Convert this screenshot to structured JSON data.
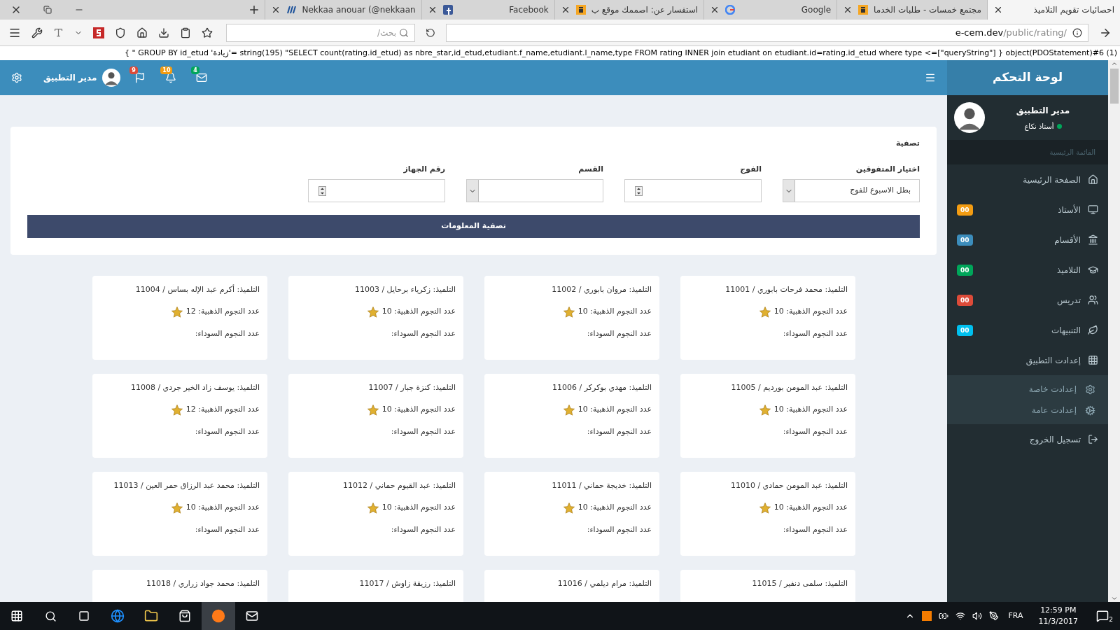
{
  "browser": {
    "tabs": [
      {
        "title": "احصائيات تقويم التلاميذ",
        "selected": true
      },
      {
        "title": "مجتمع خمسات - طلبات الخدما",
        "selected": false,
        "kind": "orange"
      },
      {
        "title": "Google",
        "selected": false,
        "kind": "google"
      },
      {
        "title": "استفسار عن: اصممك موقع ب",
        "selected": false,
        "kind": "orange"
      },
      {
        "title": "Facebook",
        "selected": false,
        "kind": "facebook"
      },
      {
        "title": "Nekkaa anouar (@nekkaan",
        "selected": false,
        "kind": "steem"
      }
    ],
    "search": {
      "placeholder": "بحث/"
    },
    "url": {
      "host": "e-cem.dev",
      "path": "/public/rating/"
    },
    "debug_output": "object(PDOStatement)#6 (1) { [\"queryString\"]=> string(195) \"SELECT count(rating.id_etud) as nbre_star,id_etud,etudiant.f_name,etudiant.l_name,type FROM rating INNER join etudiant on etudiant.id=rating.id_etud where type ='زيادة' GROUP BY id_etud \" }"
  },
  "sidebar": {
    "title": "لوحة التحكم",
    "user": {
      "name": "مدير التطبيق",
      "role": "أستاذ نكاع",
      "online": true
    },
    "section": "القائمة الرئيسية",
    "items": [
      {
        "label": "الصفحة الرئيسية",
        "kind": "home"
      },
      {
        "label": "الأستاذ",
        "kind": "monitor",
        "badge": "00",
        "color": "#f39c12"
      },
      {
        "label": "الأقسام",
        "kind": "bank",
        "badge": "00",
        "color": "#3c8dbc"
      },
      {
        "label": "التلاميذ",
        "kind": "cap",
        "badge": "00",
        "color": "#00a65a"
      },
      {
        "label": "تدريس",
        "kind": "users",
        "badge": "00",
        "color": "#dd4b39"
      },
      {
        "label": "التنبيهات",
        "kind": "leaf",
        "badge": "00",
        "color": "#00c0ef"
      },
      {
        "label": "إعدادت التطبيق",
        "kind": "grid",
        "expanded": true,
        "children": [
          {
            "label": "إعدادت خاصة",
            "kind": "gear"
          },
          {
            "label": "إعدادت عامة",
            "kind": "gears"
          }
        ]
      },
      {
        "label": "تسجيل الخروج",
        "kind": "logout"
      }
    ]
  },
  "header": {
    "user_name": "مدير التطبيق",
    "notifications": [
      {
        "kind": "mail",
        "count": "4",
        "color": "#00a65a"
      },
      {
        "kind": "bell",
        "count": "10",
        "color": "#f39c12"
      },
      {
        "kind": "flag",
        "count": "9",
        "color": "#dd4b39"
      }
    ]
  },
  "filter": {
    "title": "تصفية",
    "fields": [
      {
        "label": "اختيار المتفوقين",
        "kind": "select",
        "value": "بطل الاسبوع للفوج"
      },
      {
        "label": "الفوج",
        "kind": "number"
      },
      {
        "label": "القسم",
        "kind": "select"
      },
      {
        "label": "رقم الجهاز",
        "kind": "number"
      }
    ],
    "button": "تصفية المعلومات"
  },
  "cards": [
    {
      "title": "التلميذ: محمد فرحات بابوري / 11001",
      "gold": "عدد النجوم الذهبية: 10",
      "black": "عدد النجوم السوداء:"
    },
    {
      "title": "التلميذ: مروان بابوري / 11002",
      "gold": "عدد النجوم الذهبية: 10",
      "black": "عدد النجوم السوداء:"
    },
    {
      "title": "التلميذ: زكرياء برحايل / 11003",
      "gold": "عدد النجوم الذهبية: 10",
      "black": "عدد النجوم السوداء:"
    },
    {
      "title": "التلميذ: أكرم عبد الإله بساس / 11004",
      "gold": "عدد النجوم الذهبية: 12",
      "black": "عدد النجوم السوداء:"
    },
    {
      "title": "التلميذ: عبد المومن بورديم / 11005",
      "gold": "عدد النجوم الذهبية: 10",
      "black": "عدد النجوم السوداء:"
    },
    {
      "title": "التلميذ: مهدي بوكركر / 11006",
      "gold": "عدد النجوم الذهبية: 10",
      "black": "عدد النجوم السوداء:"
    },
    {
      "title": "التلميذ: كنزة جبار / 11007",
      "gold": "عدد النجوم الذهبية: 10",
      "black": "عدد النجوم السوداء:"
    },
    {
      "title": "التلميذ: يوسف زاد الخير جردي / 11008",
      "gold": "عدد النجوم الذهبية: 12",
      "black": "عدد النجوم السوداء:"
    },
    {
      "title": "التلميذ: عبد المومن حمادي / 11010",
      "gold": "عدد النجوم الذهبية: 10",
      "black": "عدد النجوم السوداء:"
    },
    {
      "title": "التلميذ: خديجة حماني / 11011",
      "gold": "عدد النجوم الذهبية: 10",
      "black": "عدد النجوم السوداء:"
    },
    {
      "title": "التلميذ: عبد القيوم حماني / 11012",
      "gold": "عدد النجوم الذهبية: 10",
      "black": "عدد النجوم السوداء:"
    },
    {
      "title": "التلميذ: محمد عبد الرزاق حمر العين / 11013",
      "gold": "عدد النجوم الذهبية: 10",
      "black": "عدد النجوم السوداء:"
    },
    {
      "title": "التلميذ: سلمى دنفير / 11015"
    },
    {
      "title": "التلميذ: مرام ديلمي / 11016"
    },
    {
      "title": "التلميذ: رزيقة زاوش / 11017"
    },
    {
      "title": "التلميذ: محمد جواد زراري / 11018"
    }
  ],
  "taskbar": {
    "language": "FRA",
    "time": "12:59 PM",
    "date": "11/3/2017",
    "notification_count": "2"
  }
}
